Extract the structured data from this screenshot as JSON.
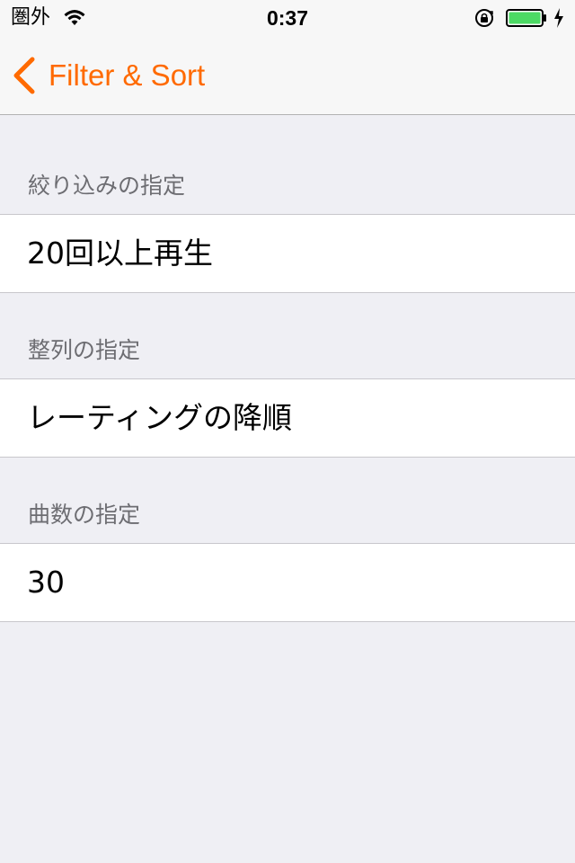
{
  "status_bar": {
    "carrier": "圏外",
    "time": "0:37",
    "wifi_icon": "wifi-icon",
    "lock_icon": "orientation-lock-icon",
    "battery_icon": "battery-icon",
    "charging_icon": "charging-bolt-icon",
    "battery_color": "#4cd964"
  },
  "nav": {
    "back_label": "Filter & Sort",
    "back_icon": "chevron-left-icon",
    "accent_color": "#ff6a00"
  },
  "sections": [
    {
      "header": "絞り込みの指定",
      "value": "20回以上再生"
    },
    {
      "header": "整列の指定",
      "value": "レーティングの降順"
    },
    {
      "header": "曲数の指定",
      "value": "30"
    }
  ]
}
